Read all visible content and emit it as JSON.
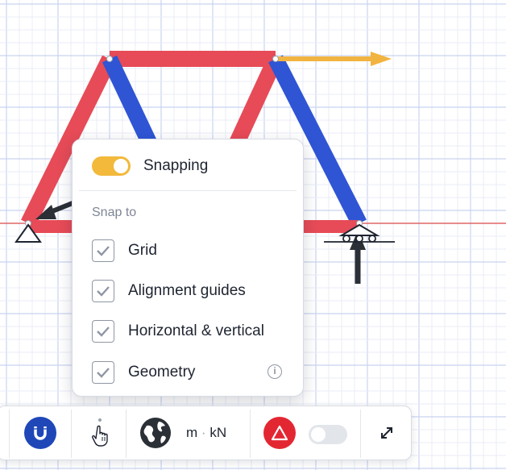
{
  "popup": {
    "snapping": {
      "label": "Snapping",
      "enabled": true
    },
    "snap_to_title": "Snap to",
    "options": [
      {
        "label": "Grid",
        "checked": true
      },
      {
        "label": "Alignment guides",
        "checked": true
      },
      {
        "label": "Horizontal & vertical",
        "checked": true
      },
      {
        "label": "Geometry",
        "checked": true,
        "info_icon": "info-icon"
      }
    ],
    "info_glyph": "i"
  },
  "toolbar": {
    "units": {
      "length": "m",
      "separator": "·",
      "force": "kN"
    },
    "icons": [
      "magnet-icon",
      "more-vertical-icon",
      "globe-icon",
      "warning-triangle-icon",
      "expand-icon"
    ],
    "toggle_enabled": false
  },
  "colors": {
    "tension_member": "#e64b57",
    "compression_member": "#2f55d4",
    "load_arrow": "#f2b440",
    "reaction_arrow": "#2b2f36",
    "axis_line": "#e06666",
    "grid_minor": "#e8ecf7",
    "grid_major": "#c9d4f0",
    "toggle_on": "#f2b93b",
    "magnet_button": "#1f47b8",
    "alert_button": "#e32732"
  }
}
